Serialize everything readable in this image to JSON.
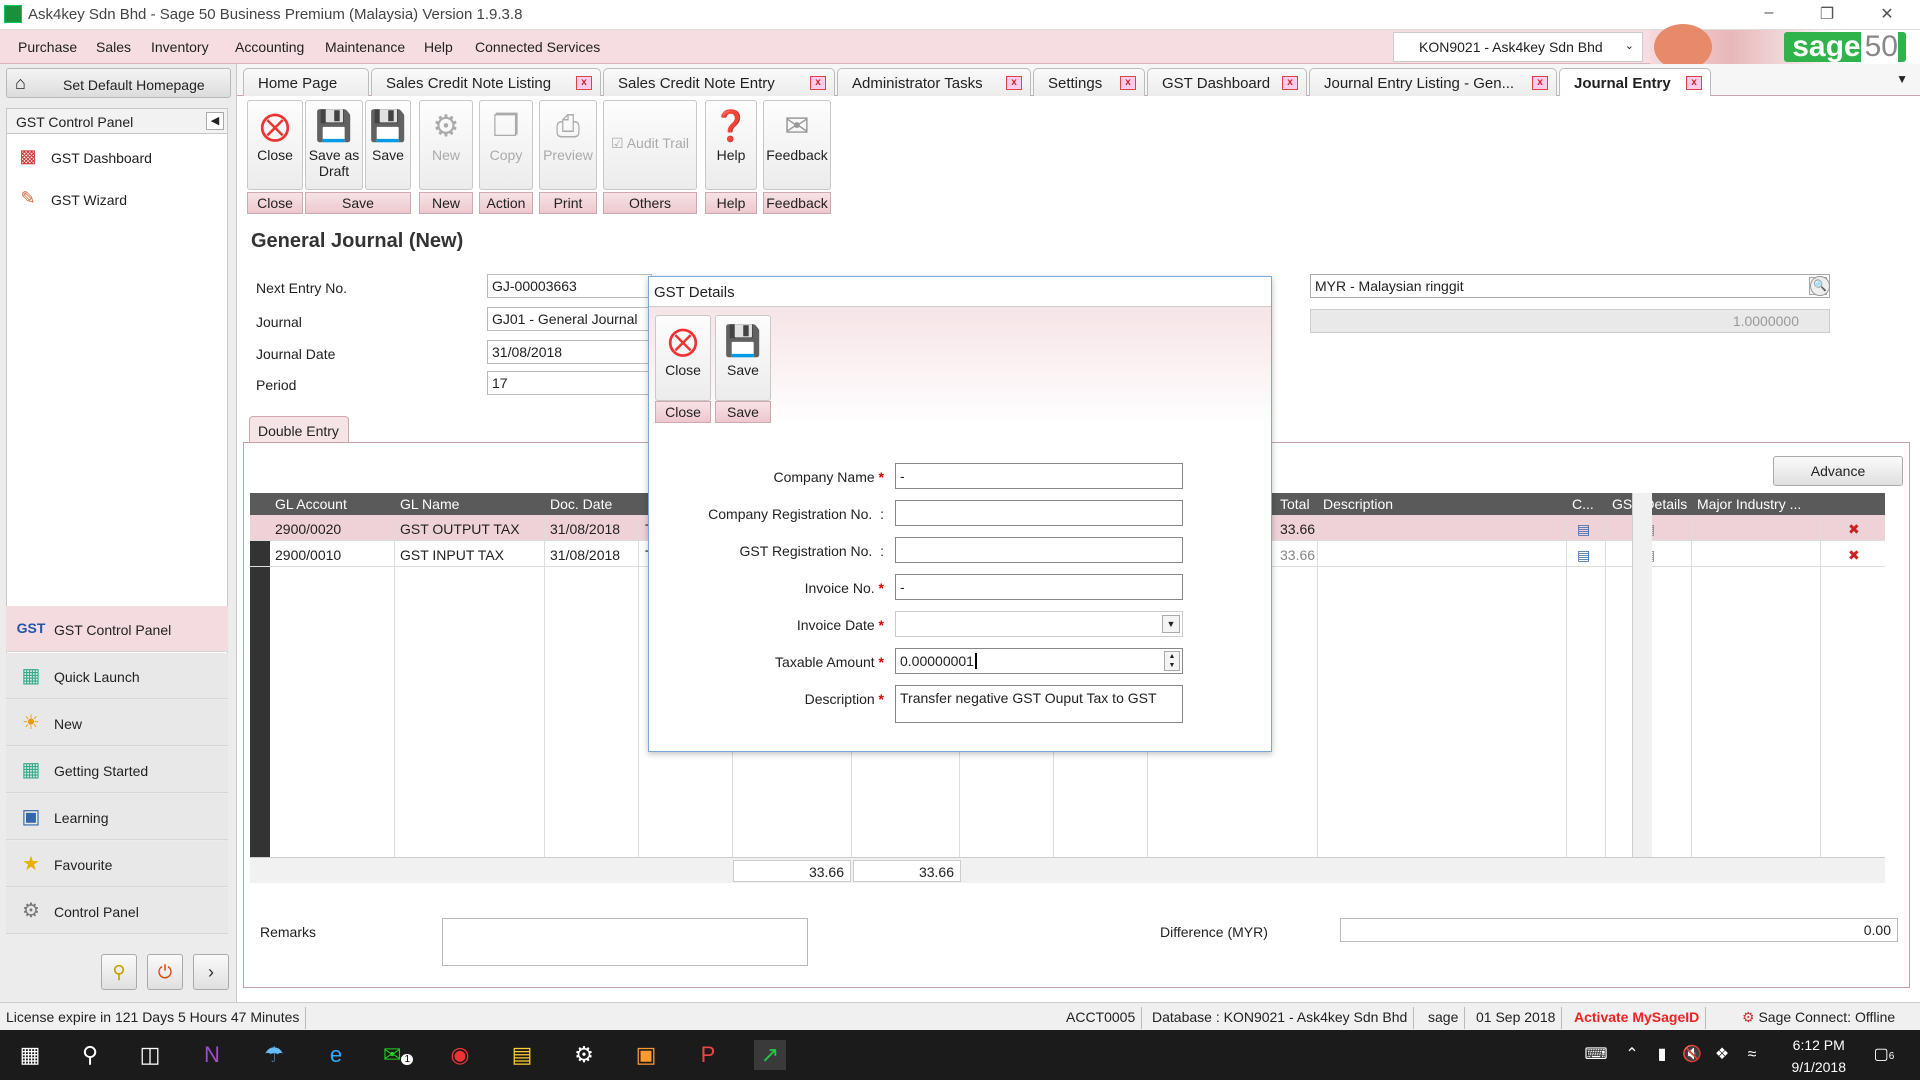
{
  "window": {
    "title": "Ask4key Sdn Bhd - Sage 50 Business Premium (Malaysia) Version 1.9.3.8",
    "min_icon": "minimize-icon",
    "max_icon": "restore-icon",
    "close_icon": "close-icon"
  },
  "menu": {
    "items": [
      "Purchase",
      "Sales",
      "Inventory",
      "Accounting",
      "Maintenance",
      "Help",
      "Connected Services"
    ],
    "company_select": "KON9021 - Ask4key Sdn Bhd",
    "brand": "sage",
    "brand_version": "50"
  },
  "left": {
    "set_default_homepage": "Set Default Homepage",
    "panel_header": "GST Control Panel",
    "tree_items": [
      "GST Dashboard",
      "GST Wizard"
    ],
    "nav": [
      {
        "label": "GST Control Panel",
        "icon": "gst-icon",
        "active": true
      },
      {
        "label": "Quick Launch",
        "icon": "quick-launch-icon"
      },
      {
        "label": "New",
        "icon": "new-icon"
      },
      {
        "label": "Getting Started",
        "icon": "getting-started-icon"
      },
      {
        "label": "Learning",
        "icon": "learning-icon"
      },
      {
        "label": "Favourite",
        "icon": "star-icon"
      },
      {
        "label": "Control Panel",
        "icon": "control-panel-icon"
      }
    ]
  },
  "tabs": [
    {
      "label": "Home Page",
      "closable": false
    },
    {
      "label": "Sales Credit Note Listing",
      "closable": true
    },
    {
      "label": "Sales Credit Note Entry",
      "closable": true
    },
    {
      "label": "Administrator Tasks",
      "closable": true
    },
    {
      "label": "Settings",
      "closable": true
    },
    {
      "label": "GST Dashboard",
      "closable": true
    },
    {
      "label": "Journal Entry Listing - Gen...",
      "closable": true
    },
    {
      "label": "Journal Entry",
      "closable": true,
      "active": true
    }
  ],
  "toolbar": {
    "buttons": {
      "close": "Close",
      "save_draft": "Save as Draft",
      "save": "Save",
      "new": "New",
      "copy": "Copy",
      "preview": "Preview",
      "audit": "Audit Trail",
      "help": "Help",
      "feedback": "Feedback"
    },
    "groups": {
      "close": "Close",
      "save": "Save",
      "new": "New",
      "action": "Action",
      "print": "Print",
      "others": "Others",
      "help": "Help",
      "feedback": "Feedback"
    }
  },
  "page": {
    "title": "General Journal (New)",
    "labels": {
      "next_entry": "Next Entry No.",
      "journal": "Journal",
      "journal_date": "Journal Date",
      "period": "Period"
    },
    "values": {
      "next_entry": "GJ-00003663",
      "journal": "GJ01 - General Journal",
      "journal_date": "31/08/2018",
      "period": "17"
    },
    "currency": "MYR - Malaysian ringgit",
    "rate": "1.0000000",
    "sub_tab": "Double Entry",
    "advance": "Advance",
    "remarks_label": "Remarks",
    "difference_label": "Difference (MYR)",
    "difference": "0.00"
  },
  "grid": {
    "headers": {
      "gl_account": "GL Account",
      "gl_name": "GL Name",
      "doc_date": "Doc. Date",
      "total": "Total",
      "description": "Description",
      "c": "C...",
      "gst_details": "GST Details",
      "major_industry": "Major Industry ..."
    },
    "rows": [
      {
        "gl_account": "2900/0020",
        "gl_name": "GST OUTPUT TAX",
        "doc_date": "31/08/2018",
        "ref": "T",
        "total": "33.66"
      },
      {
        "gl_account": "2900/0010",
        "gl_name": "GST INPUT TAX",
        "doc_date": "31/08/2018",
        "ref": "T",
        "total": "33.66"
      }
    ],
    "totals": {
      "debit": "33.66",
      "credit": "33.66"
    }
  },
  "dialog": {
    "title": "GST Details",
    "buttons": {
      "close": "Close",
      "save": "Save"
    },
    "groups": {
      "close": "Close",
      "save": "Save"
    },
    "labels": {
      "company_name": "Company Name",
      "company_reg": "Company Registration No.",
      "gst_reg": "GST Registration No.",
      "invoice_no": "Invoice No.",
      "invoice_date": "Invoice Date",
      "taxable_amount": "Taxable Amount",
      "description": "Description"
    },
    "values": {
      "company_name": "-",
      "company_reg": "",
      "gst_reg": "",
      "invoice_no": "-",
      "invoice_date": "",
      "taxable_amount": "0.00000001",
      "description": "Transfer negative GST Ouput Tax to GST"
    }
  },
  "status": {
    "license": "License expire in 121 Days 5 Hours 47 Minutes",
    "account": "ACCT0005",
    "database": "Database : KON9021 - Ask4key Sdn Bhd",
    "user": "sage",
    "date": "01 Sep 2018",
    "activate": "Activate MySageID",
    "connect": "Sage Connect: Offline"
  },
  "taskbar": {
    "time": "6:12 PM",
    "date": "9/1/2018",
    "notification_count": "6",
    "chat_badge": "1"
  },
  "colors": {
    "accent": "#f5dde1",
    "brand_green": "#2fb34a",
    "required": "#dd0000",
    "selected_row": "#eed2d7"
  }
}
